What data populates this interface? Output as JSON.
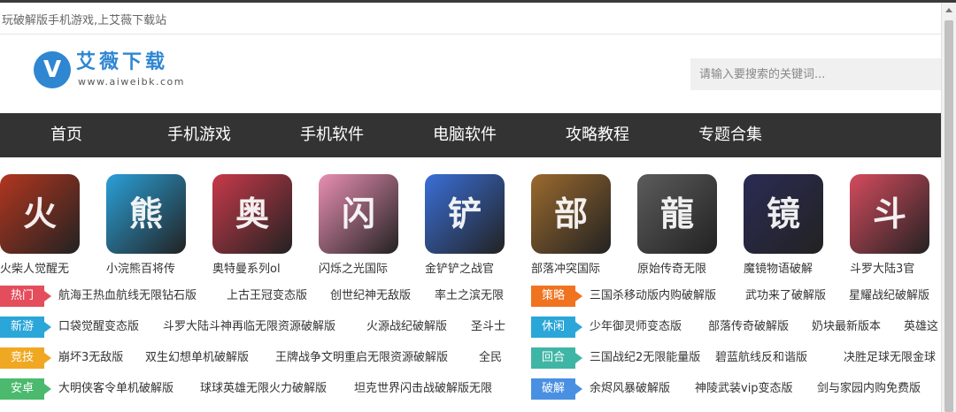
{
  "topbar": {
    "tagline": "玩破解版手机游戏,上艾薇下载站"
  },
  "logo": {
    "mark": "V",
    "name": "艾薇下载",
    "url": "www.aiweibk.com"
  },
  "search": {
    "placeholder": "请输入要搜索的关键词..."
  },
  "nav": {
    "items": [
      "首页",
      "手机游戏",
      "手机软件",
      "电脑软件",
      "攻略教程",
      "专题合集"
    ]
  },
  "apps": [
    {
      "label": "火柴人觉醒无",
      "color": "#b2361f",
      "glyph": "火"
    },
    {
      "label": "小浣熊百将传",
      "color": "#2aa0d8",
      "glyph": "熊"
    },
    {
      "label": "奥特曼系列ol",
      "color": "#c8394a",
      "glyph": "奥"
    },
    {
      "label": "闪烁之光国际",
      "color": "#e98fb2",
      "glyph": "闪"
    },
    {
      "label": "金铲铲之战官",
      "color": "#3a6fd8",
      "glyph": "铲"
    },
    {
      "label": "部落冲突国际",
      "color": "#9b6a2e",
      "glyph": "部"
    },
    {
      "label": "原始传奇无限",
      "color": "#5c5c5c",
      "glyph": "龍"
    },
    {
      "label": "魔镜物语破解",
      "color": "#2b2b55",
      "glyph": "镜"
    },
    {
      "label": "斗罗大陆3官",
      "color": "#d54b5e",
      "glyph": "斗"
    }
  ],
  "categories_left": [
    {
      "tag": "热门",
      "color": "#e44d5b",
      "links": [
        "航海王热血航线无限钻石版",
        "上古王冠变态版",
        "创世纪神无敌版",
        "率土之滨无限"
      ]
    },
    {
      "tag": "新游",
      "color": "#2aa6d8",
      "links": [
        "口袋觉醒变态版",
        "斗罗大陆斗神再临无限资源破解版",
        "火源战纪破解版",
        "圣斗士"
      ]
    },
    {
      "tag": "竞技",
      "color": "#f0a823",
      "links": [
        "崩坏3无敌版",
        "双生幻想单机破解版",
        "王牌战争文明重启无限资源破解版",
        "全民"
      ]
    },
    {
      "tag": "安卓",
      "color": "#4cba6e",
      "links": [
        "大明侠客令单机破解版",
        "球球英雄无限火力破解版",
        "坦克世界闪击战破解版无限"
      ]
    }
  ],
  "categories_right": [
    {
      "tag": "策略",
      "color": "#f0731f",
      "links": [
        "三国杀移动版内购破解版",
        "武功来了破解版",
        "星耀战纪破解版"
      ]
    },
    {
      "tag": "休闲",
      "color": "#2aa6d8",
      "links": [
        "少年御灵师变态版",
        "部落传奇破解版",
        "奶块最新版本",
        "英雄这"
      ]
    },
    {
      "tag": "回合",
      "color": "#3fb5a5",
      "links": [
        "三国战纪2无限能量版",
        "碧蓝航线反和谐版",
        "决胜足球无限金球"
      ]
    },
    {
      "tag": "破解",
      "color": "#4a90e2",
      "links": [
        "余烬风暴破解版",
        "神陵武装vip变态版",
        "剑与家园内购免费版"
      ]
    }
  ]
}
